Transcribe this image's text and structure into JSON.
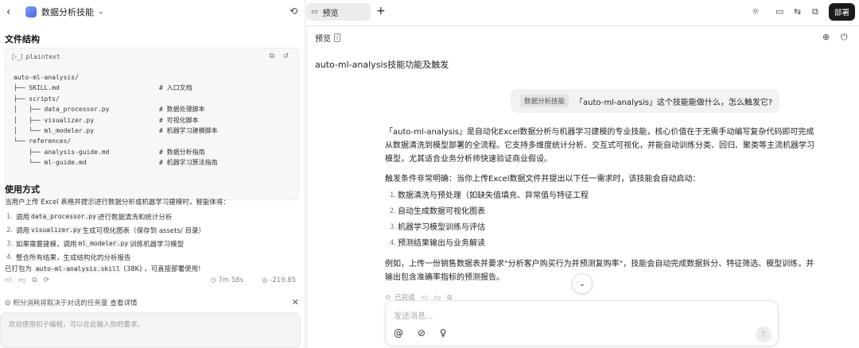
{
  "left": {
    "header": {
      "skill_name": "数据分析技能",
      "back_icon": "chevron-left-icon",
      "history_icon": "history-icon"
    },
    "file_structure": {
      "title": "文件结构",
      "code_lang": "plaintext",
      "code": "auto-ml-analysis/\n├── SKILL.md                          # 入口文档\n├── scripts/\n│   ├── data_processor.py             # 数据处理脚本\n│   ├── visualizer.py                 # 可视化脚本\n│   └── ml_modeler.py                 # 机器学习建模脚本\n└── references/\n    ├── analysis-guide.md             # 数据分析指南\n    └── ml-guide.md                   # 机器学习算法指南"
    },
    "usage": {
      "title": "使用方式",
      "intro": "当用户上传 Excel 表格并提示进行数据分析或机器学习建模时，智能体将：",
      "steps": [
        {
          "num": "1.",
          "pre": "调用 ",
          "code": "data_processor.py",
          "post": " 进行数据清洗和统计分析"
        },
        {
          "num": "2.",
          "pre": "调用 ",
          "code": "visualizer.py",
          "post": " 生成可视化图表（保存到 assets/ 目录）"
        },
        {
          "num": "3.",
          "pre": "如果需要建模，调用 ",
          "code": "ml_modeler.py",
          "post": " 训练机器学习模型"
        },
        {
          "num": "4.",
          "pre": "整合所有结果，生成结构化的分析报告",
          "code": "",
          "post": ""
        }
      ],
      "packaged_pre": "已打包为 ",
      "packaged_code": "auto-ml-analysis.skill",
      "packaged_post": " (38K) ，可直接部署使用!"
    },
    "actions": {
      "time": "7m 58s",
      "cost": "-219.85"
    },
    "notice": {
      "text": "积分消耗将取决于对话的任务量",
      "link": "查看详情"
    },
    "input_placeholder": "欢迎使用扣子编程，可以在此输入你的要求。"
  },
  "right": {
    "tab_label": "预览",
    "deploy_label": "部署",
    "panel_title": "预览",
    "chat_title": "auto-ml-analysis技能功能及触发",
    "user_tag": "数据分析技能",
    "user_question": "「auto-ml-analysis」这个技能能做什么，怎么触发它?",
    "answer_intro": "「auto-ml-analysis」是自动化Excel数据分析与机器学习建模的专业技能，核心价值在于无需手动编写复杂代码即可完成从数据清洗到模型部署的全流程。它支持多维度统计分析、交互式可视化，并能自动训练分类、回归、聚类等主流机器学习模型，尤其适合业务分析师快速验证商业假设。",
    "trigger_intro": "触发条件非常明确：当你上传Excel数据文件并提出以下任一需求时，该技能会自动启动：",
    "triggers": [
      {
        "num": "1.",
        "text": "数据清洗与预处理（如缺失值填充、异常值与特征工程"
      },
      {
        "num": "2.",
        "text": "自动生成数据可视化图表"
      },
      {
        "num": "3.",
        "text": "机器学习模型训练与评估"
      },
      {
        "num": "4.",
        "text": "预测结果输出与业务解读"
      }
    ],
    "example": "例如，上传一份销售数据表并要求\"分析客户购买行为并预测复购率\"，技能会自动完成数据拆分、特征筛选、模型训练，并输出包含准确率指标的预测报告。",
    "done_label": "已完成",
    "input_placeholder": "发送消息..."
  }
}
